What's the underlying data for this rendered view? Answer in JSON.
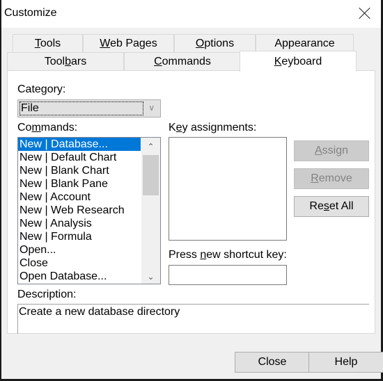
{
  "window": {
    "title": "Customize"
  },
  "tabs": {
    "row_back": [
      {
        "label_u": "T",
        "label_rest": "ools"
      },
      {
        "label_u": "W",
        "label_rest": "eb Pages"
      },
      {
        "label_u": "O",
        "label_rest": "ptions"
      },
      {
        "label_u": "",
        "label_rest": "Appearance"
      }
    ],
    "row_front": [
      {
        "label_pre": "Tool",
        "label_u": "b",
        "label_rest": "ars"
      },
      {
        "label_pre": "",
        "label_u": "C",
        "label_rest": "ommands"
      },
      {
        "label_pre": "",
        "label_u": "K",
        "label_rest": "eyboard",
        "active": true
      }
    ]
  },
  "category": {
    "label_pre": "Cate",
    "label_u": "g",
    "label_rest": "ory:",
    "value": "File"
  },
  "commands": {
    "label_pre": "Co",
    "label_u": "m",
    "label_rest": "mands:",
    "items": [
      "New | Database...",
      "New | Default Chart",
      "New | Blank Chart",
      "New | Blank Pane",
      "New | Account",
      "New | Web Research",
      "New | Analysis",
      "New | Formula",
      "Open...",
      "Close",
      "Open Database..."
    ],
    "selected_index": 0
  },
  "key_assignments": {
    "label_pre": "K",
    "label_u": "e",
    "label_rest": "y assignments:",
    "items": []
  },
  "shortcut": {
    "label_pre": "Press ",
    "label_u": "n",
    "label_rest": "ew shortcut key:",
    "value": ""
  },
  "buttons": {
    "assign": {
      "u": "A",
      "rest": "ssign",
      "enabled": false
    },
    "remove": {
      "u": "R",
      "rest": "emove",
      "enabled": false
    },
    "reset": {
      "pre": "Re",
      "u": "s",
      "rest": "et All",
      "enabled": true
    },
    "close": "Close",
    "help": "Help"
  },
  "description": {
    "label": "Description:",
    "text": "Create a new database directory"
  }
}
